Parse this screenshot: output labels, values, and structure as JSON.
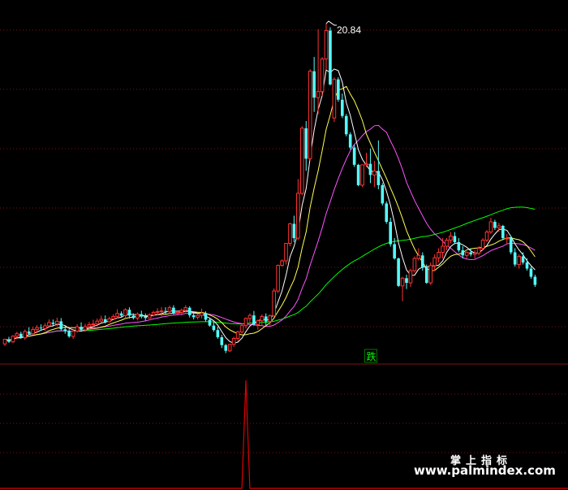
{
  "colors": {
    "background": "#000000",
    "grid": "#7a1414",
    "candle_up": "#ff3232",
    "candle_down": "#54ffff",
    "ma5": "#ffffff",
    "ma10": "#ffff54",
    "ma20": "#ff54ff",
    "ma60": "#00ff00",
    "signal_line": "#e00000",
    "signal_label": "#00ff00",
    "watermark": "#ffffff"
  },
  "chart_data": [
    {
      "type": "candlestick",
      "panel": "price",
      "ylim": [
        4.15,
        22.0
      ],
      "grid": true,
      "peak_label": "20.84",
      "signal_label": "跌",
      "signal_index": 91,
      "ohlc": [
        [
          5.1,
          5.33,
          5.0,
          5.33
        ],
        [
          5.33,
          5.45,
          5.15,
          5.2
        ],
        [
          5.2,
          5.53,
          5.15,
          5.48
        ],
        [
          5.48,
          5.7,
          5.33,
          5.6
        ],
        [
          5.6,
          5.7,
          5.35,
          5.4
        ],
        [
          5.4,
          5.81,
          5.3,
          5.71
        ],
        [
          5.71,
          5.92,
          5.55,
          5.6
        ],
        [
          5.6,
          5.94,
          5.55,
          5.81
        ],
        [
          5.81,
          6.02,
          5.62,
          5.9
        ],
        [
          5.9,
          6.06,
          5.75,
          5.86
        ],
        [
          5.86,
          6.12,
          5.75,
          5.99
        ],
        [
          5.99,
          6.3,
          5.9,
          6.15
        ],
        [
          6.15,
          6.3,
          5.95,
          6.08
        ],
        [
          6.08,
          6.39,
          5.95,
          6.21
        ],
        [
          6.21,
          6.37,
          5.75,
          5.82
        ],
        [
          5.82,
          5.97,
          5.6,
          5.73
        ],
        [
          5.73,
          5.82,
          5.4,
          5.47
        ],
        [
          5.47,
          5.83,
          5.35,
          5.73
        ],
        [
          5.73,
          6.07,
          5.65,
          5.94
        ],
        [
          5.94,
          6.16,
          5.7,
          5.79
        ],
        [
          5.79,
          6.09,
          5.7,
          5.95
        ],
        [
          5.95,
          6.18,
          5.85,
          6.05
        ],
        [
          6.05,
          6.29,
          5.85,
          6.08
        ],
        [
          6.08,
          6.35,
          5.95,
          6.22
        ],
        [
          6.22,
          6.49,
          6.15,
          6.31
        ],
        [
          6.31,
          6.5,
          6.1,
          6.19
        ],
        [
          6.19,
          6.44,
          6.15,
          6.33
        ],
        [
          6.33,
          6.56,
          6.3,
          6.45
        ],
        [
          6.45,
          6.8,
          6.35,
          6.6
        ],
        [
          6.6,
          6.7,
          6.4,
          6.49
        ],
        [
          6.49,
          6.85,
          6.35,
          6.78
        ],
        [
          6.78,
          6.9,
          6.35,
          6.49
        ],
        [
          6.49,
          6.6,
          6.3,
          6.37
        ],
        [
          6.37,
          6.65,
          6.25,
          6.56
        ],
        [
          6.56,
          6.73,
          6.35,
          6.44
        ],
        [
          6.44,
          6.6,
          6.25,
          6.37
        ],
        [
          6.37,
          6.61,
          6.35,
          6.52
        ],
        [
          6.52,
          6.73,
          6.45,
          6.65
        ],
        [
          6.65,
          6.85,
          6.5,
          6.69
        ],
        [
          6.69,
          6.91,
          6.45,
          6.72
        ],
        [
          6.72,
          6.9,
          6.55,
          6.68
        ],
        [
          6.68,
          6.99,
          6.55,
          6.88
        ],
        [
          6.88,
          7.0,
          6.55,
          6.6
        ],
        [
          6.6,
          6.75,
          6.5,
          6.65
        ],
        [
          6.65,
          6.84,
          6.5,
          6.75
        ],
        [
          6.75,
          7.0,
          6.65,
          6.88
        ],
        [
          6.88,
          6.95,
          6.4,
          6.51
        ],
        [
          6.51,
          6.66,
          6.3,
          6.41
        ],
        [
          6.41,
          6.6,
          6.3,
          6.5
        ],
        [
          6.5,
          6.83,
          6.35,
          6.61
        ],
        [
          6.61,
          6.7,
          6.2,
          6.29
        ],
        [
          6.29,
          6.4,
          5.95,
          6.0
        ],
        [
          6.0,
          6.2,
          5.7,
          5.78
        ],
        [
          5.78,
          5.95,
          5.35,
          5.43
        ],
        [
          5.43,
          5.55,
          4.9,
          5.04
        ],
        [
          5.04,
          5.1,
          4.65,
          4.76
        ],
        [
          4.76,
          5.1,
          4.7,
          5.08
        ],
        [
          5.08,
          5.45,
          4.95,
          5.37
        ],
        [
          5.37,
          5.75,
          5.25,
          5.69
        ],
        [
          5.69,
          6.1,
          5.6,
          6.0
        ],
        [
          6.0,
          6.4,
          5.85,
          6.35
        ],
        [
          6.35,
          6.6,
          6.1,
          6.5
        ],
        [
          6.5,
          6.72,
          6.0,
          6.05
        ],
        [
          6.05,
          6.3,
          5.8,
          6.24
        ],
        [
          6.24,
          6.55,
          6.0,
          6.45
        ],
        [
          6.45,
          6.6,
          6.0,
          6.2
        ],
        [
          6.2,
          6.55,
          6.0,
          6.48
        ],
        [
          6.48,
          7.83,
          6.4,
          7.7
        ],
        [
          7.7,
          9.0,
          7.6,
          8.96
        ],
        [
          8.96,
          9.25,
          8.9,
          9.18
        ],
        [
          9.18,
          10.05,
          9.0,
          10.04
        ],
        [
          10.04,
          11.05,
          9.9,
          11.0
        ],
        [
          11.0,
          11.4,
          10.1,
          10.3
        ],
        [
          10.3,
          13.2,
          10.2,
          12.5
        ],
        [
          12.5,
          15.8,
          12.4,
          15.7
        ],
        [
          15.7,
          16.05,
          13.6,
          14.2
        ],
        [
          14.2,
          18.6,
          14.1,
          18.5
        ],
        [
          18.5,
          19.2,
          16.5,
          17.2
        ],
        [
          17.2,
          20.56,
          16.4,
          17.5
        ],
        [
          17.5,
          19.2,
          17.3,
          19.1
        ],
        [
          19.1,
          20.84,
          18.6,
          20.5
        ],
        [
          20.5,
          20.66,
          17.8,
          17.85
        ],
        [
          16.2,
          18.2,
          16.0,
          18.1
        ],
        [
          18.1,
          18.2,
          17.0,
          17.1
        ],
        [
          17.1,
          17.4,
          16.2,
          16.3
        ],
        [
          16.3,
          16.4,
          15.3,
          15.4
        ],
        [
          15.4,
          15.5,
          14.65,
          14.75
        ],
        [
          14.75,
          14.9,
          13.8,
          13.9
        ],
        [
          13.9,
          13.95,
          12.85,
          12.9
        ],
        [
          12.9,
          13.9,
          12.8,
          13.9
        ],
        [
          13.9,
          14.5,
          13.8,
          13.95
        ],
        [
          13.95,
          14.7,
          13.0,
          13.4
        ],
        [
          13.4,
          14.1,
          12.8,
          13.6
        ],
        [
          13.6,
          15.1,
          12.7,
          12.9
        ],
        [
          12.9,
          13.0,
          11.9,
          12.0
        ],
        [
          12.0,
          12.1,
          11.0,
          11.1
        ],
        [
          11.1,
          11.3,
          9.88,
          10.0
        ],
        [
          10.0,
          10.3,
          9.24,
          9.3
        ],
        [
          9.3,
          9.34,
          7.9,
          7.95
        ],
        [
          7.95,
          8.4,
          7.2,
          8.33
        ],
        [
          8.33,
          8.5,
          7.8,
          8.1
        ],
        [
          8.1,
          8.8,
          7.9,
          8.7
        ],
        [
          8.7,
          9.4,
          8.6,
          9.3
        ],
        [
          9.3,
          9.8,
          9.2,
          9.45
        ],
        [
          9.45,
          9.6,
          8.7,
          8.85
        ],
        [
          8.85,
          9.0,
          8.05,
          8.1
        ],
        [
          8.1,
          9.1,
          8.0,
          8.95
        ],
        [
          8.95,
          9.5,
          8.7,
          9.33
        ],
        [
          9.33,
          9.8,
          9.1,
          9.6
        ],
        [
          9.6,
          10.3,
          9.3,
          9.9
        ],
        [
          9.9,
          10.3,
          9.7,
          10.2
        ],
        [
          10.2,
          10.6,
          10.05,
          10.4
        ],
        [
          10.4,
          10.6,
          10.0,
          10.1
        ],
        [
          10.1,
          10.3,
          9.6,
          9.7
        ],
        [
          9.7,
          9.9,
          9.3,
          9.45
        ],
        [
          9.45,
          9.65,
          9.3,
          9.6
        ],
        [
          9.6,
          9.8,
          9.4,
          9.5
        ],
        [
          9.5,
          9.7,
          9.3,
          9.56
        ],
        [
          9.56,
          9.9,
          9.45,
          9.8
        ],
        [
          9.8,
          10.3,
          9.7,
          10.2
        ],
        [
          10.2,
          10.7,
          10.1,
          10.6
        ],
        [
          10.6,
          11.3,
          10.5,
          11.1
        ],
        [
          11.1,
          11.2,
          10.7,
          10.8
        ],
        [
          10.8,
          11.05,
          10.6,
          10.9
        ],
        [
          10.9,
          10.95,
          10.2,
          10.3
        ],
        [
          10.3,
          10.5,
          10.0,
          10.3
        ],
        [
          10.3,
          10.4,
          9.5,
          9.6
        ],
        [
          9.6,
          9.8,
          8.9,
          9.0
        ],
        [
          9.0,
          9.5,
          8.8,
          9.4
        ],
        [
          9.4,
          9.6,
          9.0,
          9.1
        ],
        [
          9.1,
          9.3,
          8.7,
          8.8
        ],
        [
          8.8,
          8.9,
          8.3,
          8.4
        ],
        [
          8.4,
          8.5,
          7.9,
          8.0
        ]
      ]
    },
    {
      "type": "line",
      "panel": "indicator",
      "series": [
        {
          "values": [
            0,
            0,
            0,
            0,
            0,
            0,
            0,
            0,
            0,
            0,
            0,
            0,
            0,
            0,
            0,
            0,
            0,
            0,
            0,
            0,
            0,
            0,
            0,
            0,
            0,
            0,
            0,
            0,
            0,
            0,
            0,
            0,
            0,
            0,
            0,
            0,
            0,
            0,
            0,
            0,
            0,
            0,
            0,
            0,
            0,
            0,
            0,
            0,
            0,
            0,
            0,
            0,
            0,
            0,
            0,
            0,
            0,
            0,
            0,
            0,
            1,
            0,
            0,
            0,
            0,
            0,
            0,
            0,
            0,
            0,
            0,
            0,
            0,
            0,
            0,
            0,
            0,
            0,
            0,
            0,
            0,
            0,
            0,
            0,
            0,
            0,
            0,
            0,
            0,
            0,
            0,
            0,
            0,
            0,
            0,
            0,
            0,
            0,
            0,
            0,
            0,
            0,
            0,
            0,
            0,
            0,
            0,
            0,
            0,
            0,
            0,
            0,
            0,
            0,
            0,
            0,
            0,
            0,
            0,
            0,
            0,
            0,
            0,
            0,
            0,
            0,
            0,
            0,
            0,
            0,
            0,
            0,
            0,
            0,
            0,
            0,
            0,
            0,
            0,
            0,
            0,
            0
          ]
        }
      ]
    }
  ],
  "watermark": {
    "line1": "掌上指标",
    "line2": "www.palmindex.com"
  }
}
